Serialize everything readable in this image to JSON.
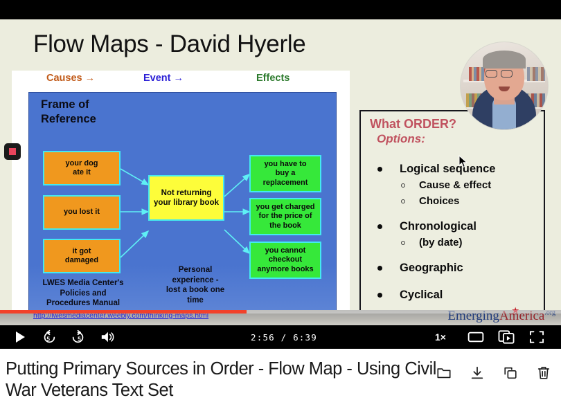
{
  "slide": {
    "title": "Flow Maps - David Hyerle",
    "map": {
      "headers": [
        {
          "label": "Causes →",
          "color": "#c15a18"
        },
        {
          "label": "Event →",
          "color": "#2a1ed6"
        },
        {
          "label": "Effects",
          "color": "#2c7a2c"
        }
      ],
      "frame_title": "Frame of\nReference",
      "causes": [
        "your dog\nate it",
        "you lost it",
        "it got\ndamaged"
      ],
      "center": "Not returning\nyour library book",
      "effects": [
        "you have to\nbuy a\nreplacement",
        "you get charged\nfor the price of\nthe book",
        "you cannot\ncheckout\nanymore books"
      ],
      "caption_left": "LWES Media Center's\nPolicies and\nProcedures Manual",
      "caption_center": "Personal\nexperience -\nlost a book one\ntime"
    },
    "options": {
      "question": "What ORDER?",
      "subtitle": "Options:",
      "items": [
        {
          "level": 1,
          "label": "Logical sequence"
        },
        {
          "level": 2,
          "label": "Cause & effect"
        },
        {
          "level": 2,
          "label": "Choices"
        },
        {
          "level": 1,
          "label": "Chronological"
        },
        {
          "level": 2,
          "label": "(by date)"
        },
        {
          "level": 1,
          "label": "Geographic"
        },
        {
          "level": 1,
          "label": "Cyclical"
        }
      ]
    },
    "source_url": "http://lwesmediacenter.weebly.com/thinking-maps.html",
    "brand": {
      "part1": "Emerging",
      "part2": "America",
      "tld": ".org"
    }
  },
  "player": {
    "time_display": "2:56 / 6:39",
    "current_time": "2:56",
    "duration": "6:39",
    "progress_percent": 44,
    "speed_label": "1×",
    "accent_color": "#f2412a",
    "controls": [
      {
        "name": "play-button",
        "label": "Play"
      },
      {
        "name": "rewind-5-button",
        "label": "5"
      },
      {
        "name": "forward-5-button",
        "label": "5"
      },
      {
        "name": "volume-button",
        "label": "Volume"
      },
      {
        "name": "theater-mode-button",
        "label": "Theater mode"
      },
      {
        "name": "picture-in-picture-button",
        "label": "Picture in picture"
      },
      {
        "name": "fullscreen-button",
        "label": "Fullscreen"
      }
    ]
  },
  "below": {
    "video_title": "Putting Primary Sources in Order - Flow Map - Using Civil War Veterans Text Set",
    "actions": [
      {
        "name": "folder-icon",
        "label": "Move to folder"
      },
      {
        "name": "download-icon",
        "label": "Download"
      },
      {
        "name": "copy-icon",
        "label": "Copy"
      },
      {
        "name": "trash-icon",
        "label": "Delete"
      }
    ]
  }
}
